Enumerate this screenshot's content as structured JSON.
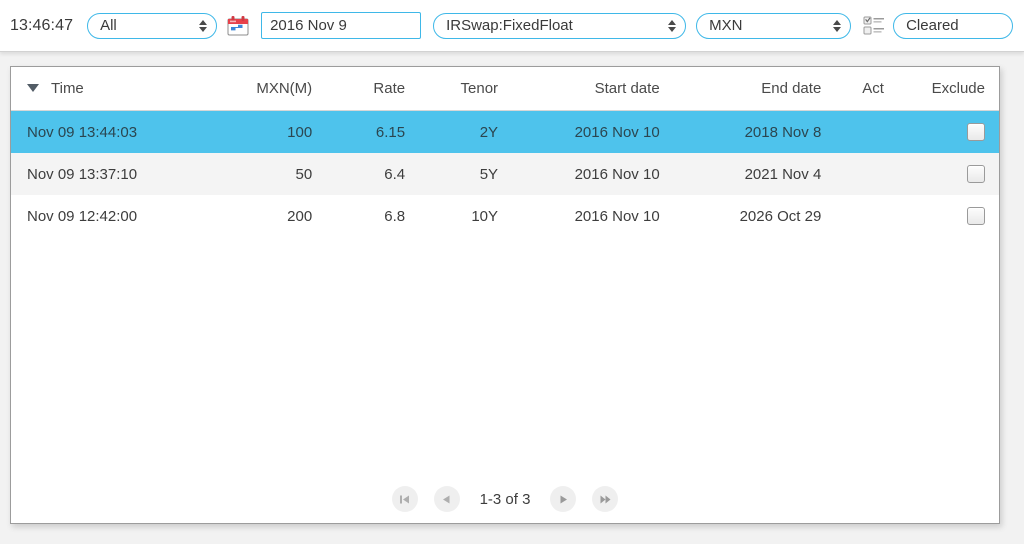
{
  "toolbar": {
    "clock": "13:46:47",
    "account_filter": {
      "value": "All",
      "name": "account-filter-select"
    },
    "calendar_icon": "calendar-icon",
    "date_field": {
      "value": "2016 Nov 9",
      "placeholder": "2016 Nov 9"
    },
    "product_filter": {
      "value": "IRSwap:FixedFloat"
    },
    "currency_filter": {
      "value": "MXN"
    },
    "columns_icon": "checklist-icon",
    "status_filter": {
      "value": "Cleared"
    }
  },
  "table": {
    "sort_column": "Time",
    "sort_direction": "descending",
    "columns": [
      {
        "key": "time",
        "label": "Time",
        "align": "left"
      },
      {
        "key": "notional",
        "label": "MXN(M)",
        "align": "right"
      },
      {
        "key": "rate",
        "label": "Rate",
        "align": "right"
      },
      {
        "key": "tenor",
        "label": "Tenor",
        "align": "right"
      },
      {
        "key": "start",
        "label": "Start date",
        "align": "right"
      },
      {
        "key": "end",
        "label": "End date",
        "align": "right"
      },
      {
        "key": "act",
        "label": "Act",
        "align": "right"
      },
      {
        "key": "exclude",
        "label": "Exclude",
        "align": "right"
      }
    ],
    "rows": [
      {
        "time": "Nov 09 13:44:03",
        "notional": "100",
        "rate": "6.15",
        "tenor": "2Y",
        "start": "2016 Nov 10",
        "end": "2018 Nov 8",
        "act": "",
        "exclude_checked": false,
        "selected": true
      },
      {
        "time": "Nov 09 13:37:10",
        "notional": "50",
        "rate": "6.4",
        "tenor": "5Y",
        "start": "2016 Nov 10",
        "end": "2021 Nov 4",
        "act": "",
        "exclude_checked": false,
        "selected": false
      },
      {
        "time": "Nov 09 12:42:00",
        "notional": "200",
        "rate": "6.8",
        "tenor": "10Y",
        "start": "2016 Nov 10",
        "end": "2026 Oct 29",
        "act": "",
        "exclude_checked": false,
        "selected": false
      }
    ]
  },
  "pager": {
    "first_label": "first-page",
    "prev_label": "previous-page",
    "range_label": "1-3 of 3",
    "next_label": "next-page",
    "last_label": "last-page"
  },
  "colors": {
    "selection_blue": "#4ec3ec",
    "control_border_blue": "#3fb8e8",
    "row_alt_gray": "#f4f4f4",
    "page_background": "#f2f2f2",
    "text": "#3d3d3d"
  }
}
